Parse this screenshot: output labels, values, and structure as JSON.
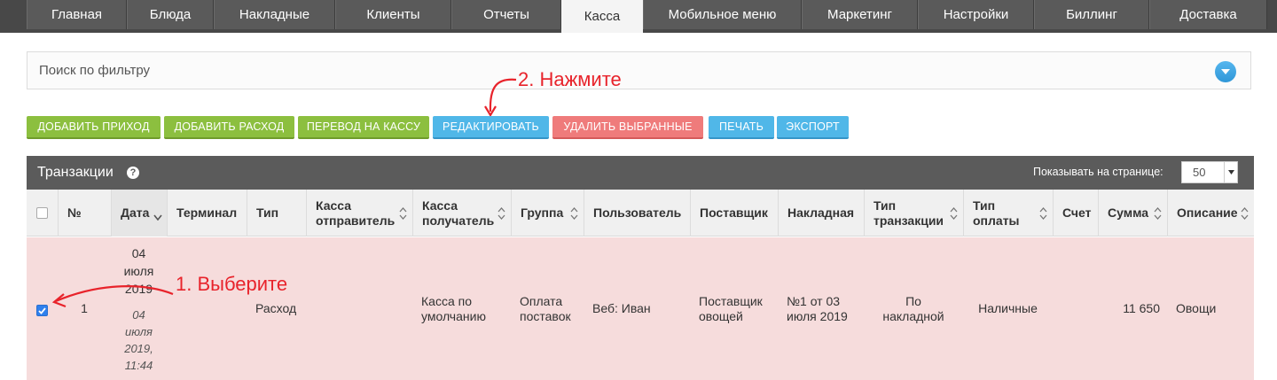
{
  "nav": {
    "tabs": [
      {
        "label": "Главная",
        "active": false
      },
      {
        "label": "Блюда",
        "active": false
      },
      {
        "label": "Накладные",
        "active": false
      },
      {
        "label": "Клиенты",
        "active": false
      },
      {
        "label": "Отчеты",
        "active": false
      },
      {
        "label": "Касса",
        "active": true
      },
      {
        "label": "Мобильное меню",
        "active": false
      },
      {
        "label": "Маркетинг",
        "active": false
      },
      {
        "label": "Настройки",
        "active": false
      },
      {
        "label": "Биллинг",
        "active": false
      },
      {
        "label": "Доставка",
        "active": false
      }
    ]
  },
  "search": {
    "placeholder": "Поиск по фильтру"
  },
  "annotations": {
    "step2": "2. Нажмите",
    "step1": "1. Выберите",
    "color": "#e8232b"
  },
  "actions": {
    "add_income": "ДОБАВИТЬ ПРИХОД",
    "add_expense": "ДОБАВИТЬ РАСХОД",
    "transfer": "ПЕРЕВОД НА КАССУ",
    "edit": "РЕДАКТИРОВАТЬ",
    "delete_selected": "УДАЛИТЬ ВЫБРАННЫЕ",
    "print": "ПЕЧАТЬ",
    "export": "ЭКСПОРТ"
  },
  "panel": {
    "title": "Транзакции",
    "help_icon": "?",
    "per_page_label": "Показывать на странице:",
    "per_page_value": "50"
  },
  "table": {
    "columns": {
      "num": "№",
      "date": "Дата",
      "terminal": "Терминал",
      "type": "Тип",
      "sender_1": "Касса",
      "sender_2": "отправитель",
      "receiver_1": "Касса",
      "receiver_2": "получатель",
      "group": "Группа",
      "user": "Пользователь",
      "supplier": "Поставщик",
      "invoice": "Накладная",
      "ttype_1": "Тип",
      "ttype_2": "транзакции",
      "ptype_1": "Тип",
      "ptype_2": "оплаты",
      "account": "Счет",
      "sum": "Сумма",
      "description": "Описание"
    },
    "row": {
      "checked": true,
      "num": "1",
      "date_1": "04",
      "date_2": "июля",
      "date_3": "2019",
      "created_1": "04",
      "created_2": "июля",
      "created_3": "2019,",
      "created_4": "11:44",
      "terminal": "",
      "type": "Расход",
      "sender": "",
      "receiver_1": "Касса по",
      "receiver_2": "умолчанию",
      "group_1": "Оплата",
      "group_2": "поставок",
      "user": "Веб: Иван",
      "supplier_1": "Поставщик",
      "supplier_2": "овощей",
      "invoice_1": "№1 от 03",
      "invoice_2": "июля 2019",
      "ttype_1": "По",
      "ttype_2": "накладной",
      "ptype": "Наличные",
      "account": "",
      "sum": "11 650",
      "description": "Овощи"
    }
  }
}
